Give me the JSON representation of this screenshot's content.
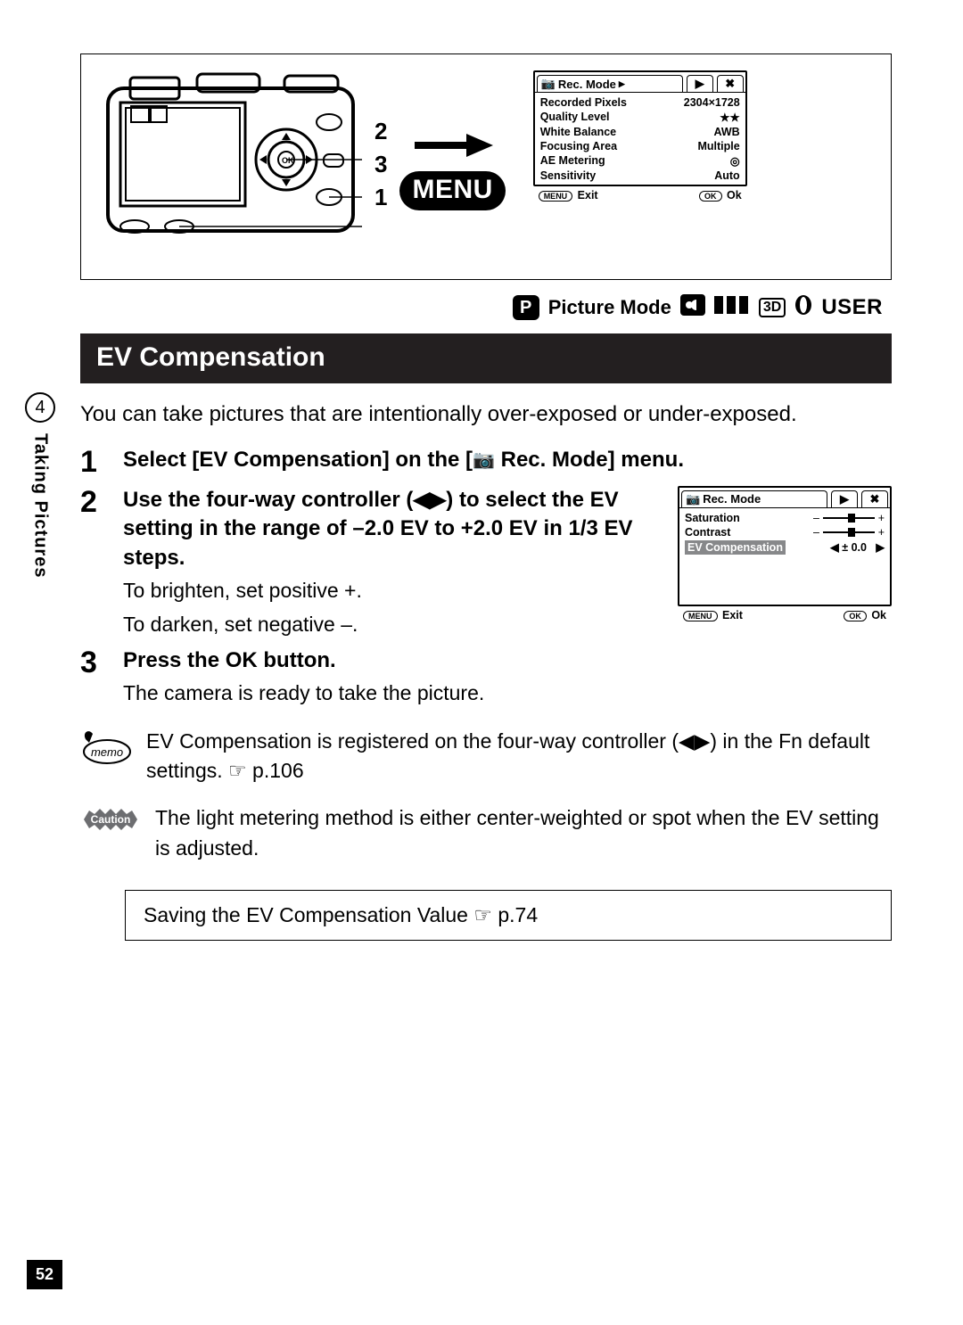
{
  "side": {
    "chapter": "4",
    "label": "Taking Pictures"
  },
  "page_number": "52",
  "diagram": {
    "step_numbers": [
      "2",
      "3",
      "1"
    ],
    "menu_button": "MENU"
  },
  "lcd_top": {
    "tab_main": "Rec. Mode",
    "rows": [
      {
        "label": "Recorded Pixels",
        "value": "2304×1728"
      },
      {
        "label": "Quality Level",
        "value": "★★"
      },
      {
        "label": "White Balance",
        "value": "AWB"
      },
      {
        "label": "Focusing Area",
        "value": "Multiple"
      },
      {
        "label": "AE Metering",
        "value": "◎"
      },
      {
        "label": "Sensitivity",
        "value": "Auto"
      }
    ],
    "footer_left": "Exit",
    "footer_left_btn": "MENU",
    "footer_right": "Ok",
    "footer_right_btn": "OK"
  },
  "mode_strip": {
    "picture_mode": "Picture Mode",
    "user": "USER",
    "three_d": "3D"
  },
  "section_title": "EV Compensation",
  "intro": "You can take pictures that are intentionally over-exposed or under-exposed.",
  "steps": {
    "s1": {
      "num": "1",
      "title_a": "Select [EV Compensation] on the [",
      "title_b": " Rec. Mode] menu."
    },
    "s2": {
      "num": "2",
      "title": "Use the four-way controller (◀▶) to select the EV setting in the range of –2.0 EV to +2.0 EV in 1/3 EV steps.",
      "sub1": "To brighten, set positive +.",
      "sub2": "To darken, set negative –."
    },
    "s3": {
      "num": "3",
      "title": "Press the OK button.",
      "sub": "The camera is ready to take the picture."
    }
  },
  "lcd_step2": {
    "tab_main": "Rec. Mode",
    "rows": {
      "saturation": "Saturation",
      "contrast": "Contrast",
      "evcomp": "EV Compensation",
      "evval": "±  0.0"
    },
    "footer_left": "Exit",
    "footer_left_btn": "MENU",
    "footer_right": "Ok",
    "footer_right_btn": "OK"
  },
  "memo": "EV Compensation is registered on the four-way controller (◀▶) in the Fn default settings. ☞ p.106",
  "caution": "The light metering method is either center-weighted or spot when the EV setting is adjusted.",
  "refbox": "Saving the EV Compensation Value ☞ p.74"
}
